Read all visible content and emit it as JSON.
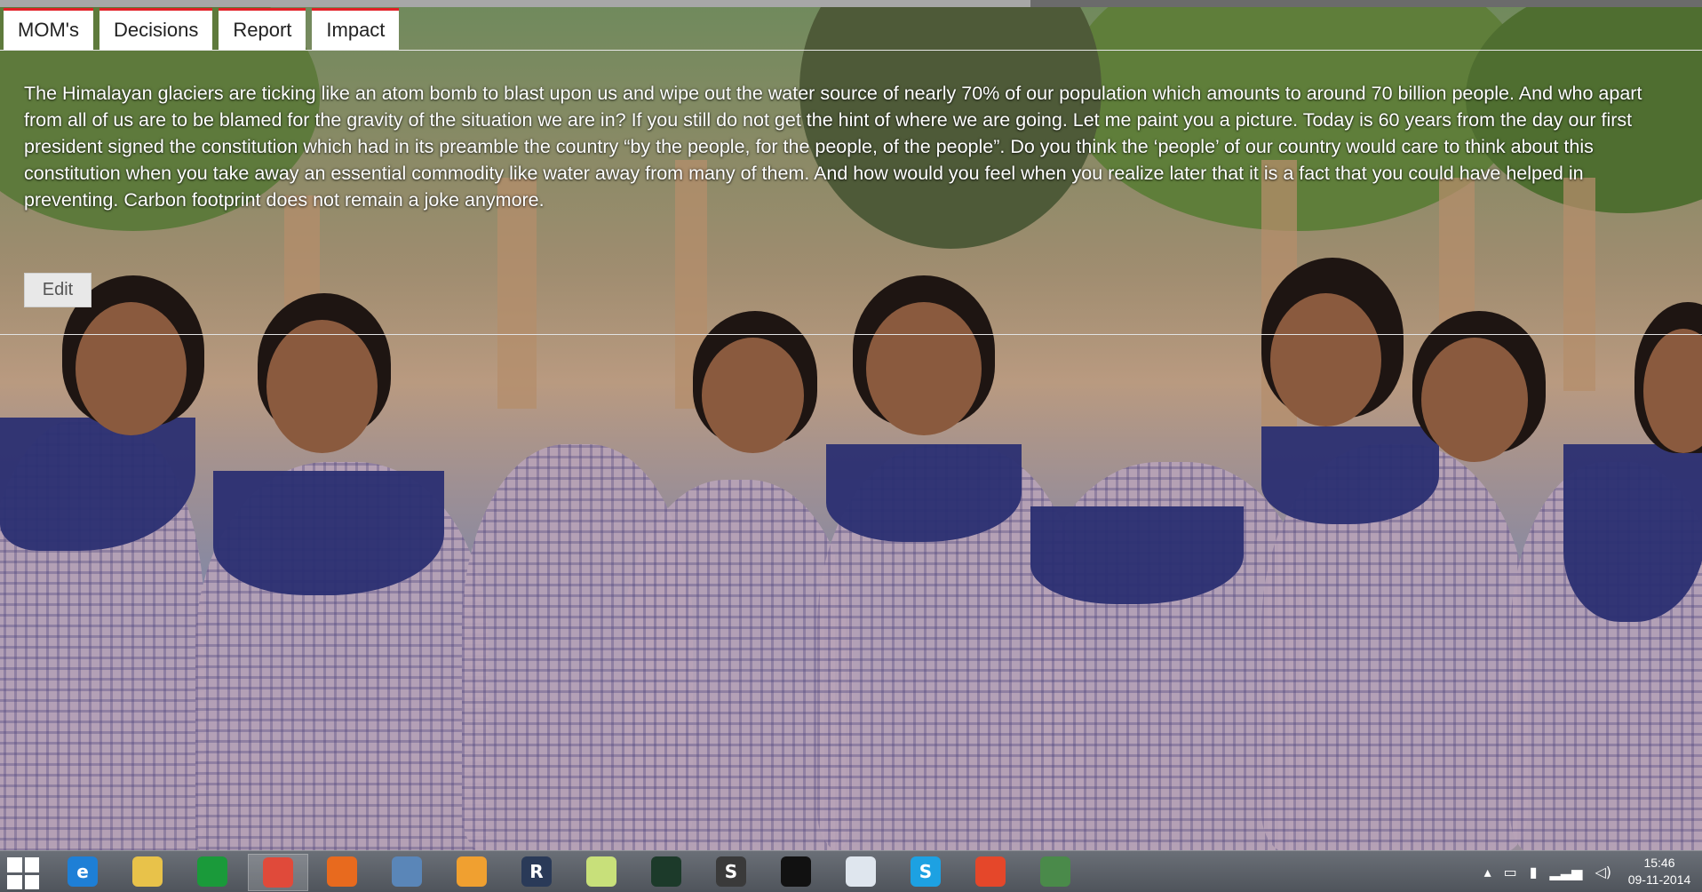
{
  "tabs": [
    {
      "label": "MOM's"
    },
    {
      "label": "Decisions"
    },
    {
      "label": "Report"
    },
    {
      "label": "Impact"
    }
  ],
  "content": {
    "paragraph": "The Himalayan glaciers are ticking like an atom bomb to blast upon us and wipe out the water source of nearly 70% of our population which amounts to around 70 billion people. And who apart from all of us are to be blamed for the gravity of the situation we are in? If you still do not get the hint of where we are going. Let me paint you a picture. Today is 60 years from the day our first president signed the constitution which had in its preamble the country “by the people, for the people, of the people”. Do you think the ‘people’ of our country would care to think about this constitution when you take away an essential commodity like water away from many of them. And how would you feel when you realize later that it is a fact that you could have helped in preventing. Carbon footprint does not remain a joke anymore.",
    "edit_label": "Edit"
  },
  "taskbar": {
    "apps": [
      {
        "name": "internet-explorer-icon",
        "glyph": "e",
        "color": "#1e7fd6"
      },
      {
        "name": "file-explorer-icon",
        "glyph": "",
        "color": "#e8c24a"
      },
      {
        "name": "store-icon",
        "glyph": "",
        "color": "#1a9a3a"
      },
      {
        "name": "chrome-icon",
        "glyph": "",
        "color": "#e04a3a"
      },
      {
        "name": "firefox-icon",
        "glyph": "",
        "color": "#e86a1e"
      },
      {
        "name": "remote-desktop-icon",
        "glyph": "",
        "color": "#5a86b8"
      },
      {
        "name": "java-icon",
        "glyph": "",
        "color": "#f0a030"
      },
      {
        "name": "r-studio-icon",
        "glyph": "R",
        "color": "#2a3a58"
      },
      {
        "name": "sticky-notes-icon",
        "glyph": "",
        "color": "#c8e07a"
      },
      {
        "name": "terminal-monitor-icon",
        "glyph": "",
        "color": "#1c3a2a"
      },
      {
        "name": "sublime-text-icon",
        "glyph": "S",
        "color": "#3a3a3a"
      },
      {
        "name": "command-prompt-icon",
        "glyph": "",
        "color": "#111111"
      },
      {
        "name": "search-document-icon",
        "glyph": "",
        "color": "#dfe6ee"
      },
      {
        "name": "skype-icon",
        "glyph": "S",
        "color": "#1da1e2"
      },
      {
        "name": "git-icon",
        "glyph": "",
        "color": "#e5472a"
      },
      {
        "name": "network-switch-icon",
        "glyph": "",
        "color": "#4a8a4a"
      }
    ],
    "clock_time": "15:46",
    "clock_date": "09-11-2014"
  }
}
